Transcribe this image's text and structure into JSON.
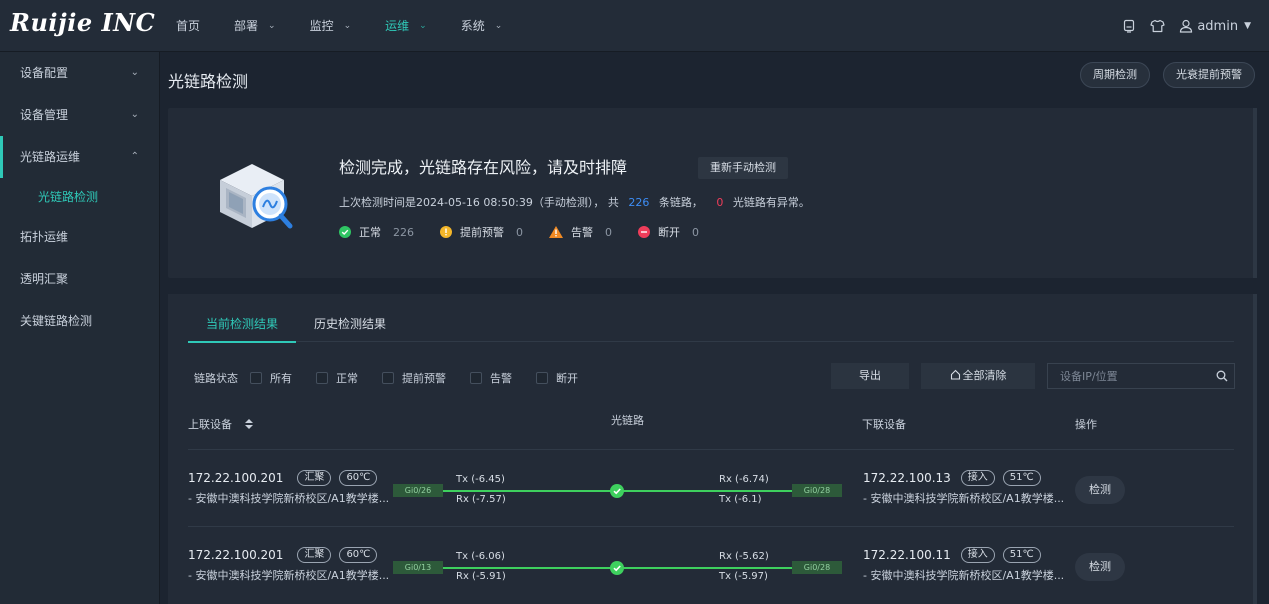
{
  "brand": {
    "logo_text": "Ruijie INC"
  },
  "nav": {
    "items": [
      {
        "label": "首页",
        "has_dropdown": false,
        "active": false
      },
      {
        "label": "部署",
        "has_dropdown": true,
        "active": false
      },
      {
        "label": "监控",
        "has_dropdown": true,
        "active": false
      },
      {
        "label": "运维",
        "has_dropdown": true,
        "active": true
      },
      {
        "label": "系统",
        "has_dropdown": true,
        "active": false
      }
    ],
    "user": "admin"
  },
  "sidebar": {
    "items": [
      {
        "label": "设备配置",
        "chevron": "down"
      },
      {
        "label": "设备管理",
        "chevron": "down"
      },
      {
        "label": "光链路运维",
        "chevron": "up"
      },
      {
        "label": "光链路检测",
        "sub": true
      },
      {
        "label": "拓扑运维"
      },
      {
        "label": "透明汇聚"
      },
      {
        "label": "关键链路检测"
      }
    ]
  },
  "page": {
    "title": "光链路检测",
    "btn_periodic": "周期检测",
    "btn_alert": "光衰提前预警"
  },
  "summary": {
    "title": "检测完成，光链路存在风险，请及时排障",
    "rerun_label": "重新手动检测",
    "info_prefix": "上次检测时间是2024-05-16 08:50:39（手动检测），  共",
    "total_links": "226",
    "info_mid": "条链路，",
    "abnormal": "0",
    "info_suffix": "光链路有异常。",
    "stats": [
      {
        "label": "正常",
        "count": "226",
        "color": "#2fc563"
      },
      {
        "label": "提前预警",
        "count": "0",
        "color": "#f3b62a"
      },
      {
        "label": "告警",
        "count": "0",
        "color": "#f08a24"
      },
      {
        "label": "断开",
        "count": "0",
        "color": "#ef3d5a"
      }
    ]
  },
  "results": {
    "tabs": [
      "当前检测结果",
      "历史检测结果"
    ],
    "filter_label": "链路状态",
    "filters": [
      "所有",
      "正常",
      "提前预警",
      "告警",
      "断开"
    ],
    "export_label": "导出",
    "clear_label": "全部清除",
    "search_placeholder": "设备IP/位置",
    "columns": {
      "upstream": "上联设备",
      "link": "光链路",
      "downstream": "下联设备",
      "action": "操作"
    },
    "rows": [
      {
        "up_ip": "172.22.100.201",
        "up_tag": "汇聚",
        "up_temp": "60℃",
        "up_loc": "- 安徽中澳科技学院新桥校区/A1教学楼...",
        "up_port": "Gi0/26",
        "tx_up": "Tx (-6.45)",
        "rx_up": "Rx (-7.57)",
        "rx_dn": "Rx (-6.74)",
        "tx_dn": "Tx (-6.1)",
        "dn_port": "Gi0/28",
        "dn_ip": "172.22.100.13",
        "dn_tag": "接入",
        "dn_temp": "51℃",
        "dn_loc": "- 安徽中澳科技学院新桥校区/A1教学楼...",
        "action": "检测"
      },
      {
        "up_ip": "172.22.100.201",
        "up_tag": "汇聚",
        "up_temp": "60℃",
        "up_loc": "- 安徽中澳科技学院新桥校区/A1教学楼...",
        "up_port": "Gi0/13",
        "tx_up": "Tx (-6.06)",
        "rx_up": "Rx (-5.91)",
        "rx_dn": "Rx (-5.62)",
        "tx_dn": "Tx (-5.97)",
        "dn_port": "Gi0/28",
        "dn_ip": "172.22.100.11",
        "dn_tag": "接入",
        "dn_temp": "51℃",
        "dn_loc": "- 安徽中澳科技学院新桥校区/A1教学楼...",
        "action": "检测"
      }
    ]
  }
}
